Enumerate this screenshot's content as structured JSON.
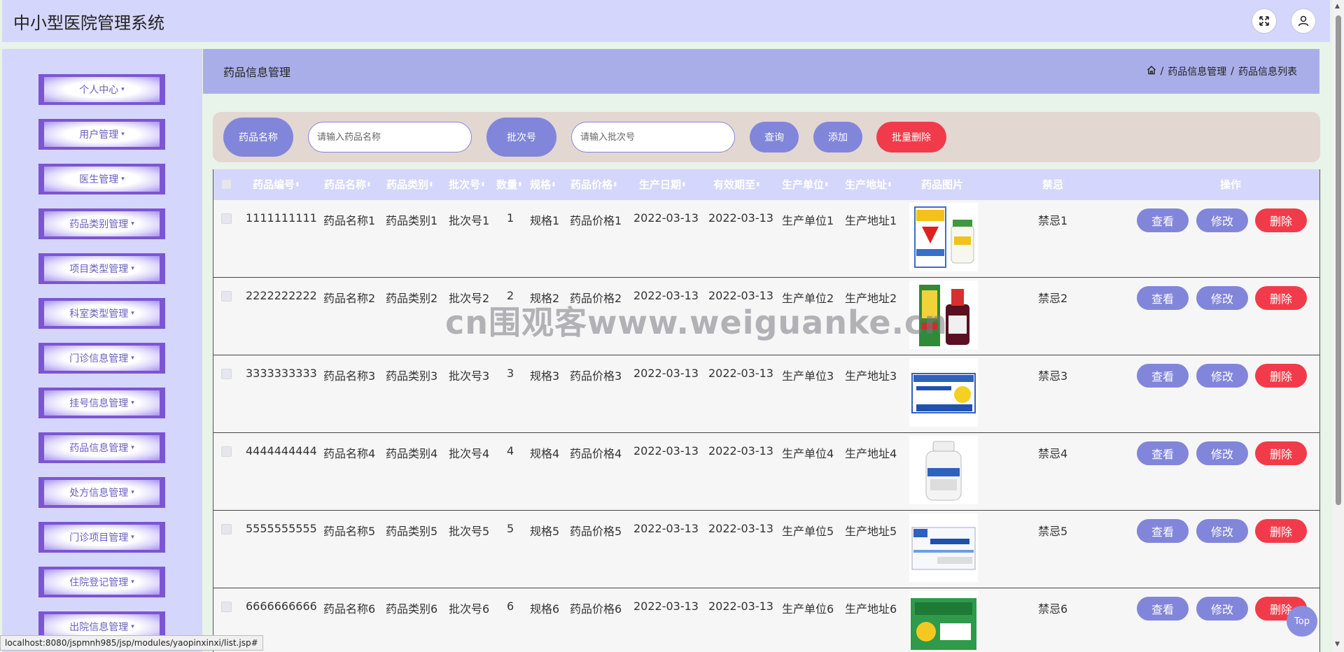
{
  "app": {
    "title": "中小型医院管理系统"
  },
  "sidebar": {
    "items": [
      {
        "label": "个人中心"
      },
      {
        "label": "用户管理"
      },
      {
        "label": "医生管理"
      },
      {
        "label": "药品类别管理"
      },
      {
        "label": "项目类型管理"
      },
      {
        "label": "科室类型管理"
      },
      {
        "label": "门诊信息管理"
      },
      {
        "label": "挂号信息管理"
      },
      {
        "label": "药品信息管理"
      },
      {
        "label": "处方信息管理"
      },
      {
        "label": "门诊项目管理"
      },
      {
        "label": "住院登记管理"
      },
      {
        "label": "出院信息管理"
      }
    ],
    "caret": "▾"
  },
  "header": {
    "page_title": "药品信息管理",
    "breadcrumb": [
      "药品信息管理",
      "药品信息列表"
    ],
    "separator": "/"
  },
  "search": {
    "name_label": "药品名称",
    "name_placeholder": "请输入药品名称",
    "batch_label": "批次号",
    "batch_placeholder": "请输入批次号",
    "query_button": "查询",
    "add_button": "添加",
    "batch_delete_button": "批量删除"
  },
  "table": {
    "columns": [
      "药品编号",
      "药品名称",
      "药品类别",
      "批次号",
      "数量",
      "规格",
      "药品价格",
      "生产日期",
      "有效期至",
      "生产单位",
      "生产地址",
      "药品图片",
      "禁忌",
      "操作"
    ],
    "sort_icon": "⬍",
    "rows": [
      {
        "id": "1111111111",
        "name": "药品名称1",
        "category": "药品类别1",
        "batch": "批次号1",
        "qty": "1",
        "spec": "规格1",
        "price": "药品价格1",
        "mfg_date": "2022-03-13",
        "exp_date": "2022-03-13",
        "maker": "生产单位1",
        "address": "生产地址1",
        "taboo": "禁忌1",
        "image": "vitamin-c-tablets-image"
      },
      {
        "id": "2222222222",
        "name": "药品名称2",
        "category": "药品类别2",
        "batch": "批次号2",
        "qty": "2",
        "spec": "规格2",
        "price": "药品价格2",
        "mfg_date": "2022-03-13",
        "exp_date": "2022-03-13",
        "maker": "生产单位2",
        "address": "生产地址2",
        "taboo": "禁忌2",
        "image": "syrup-bottle-image"
      },
      {
        "id": "3333333333",
        "name": "药品名称3",
        "category": "药品类别3",
        "batch": "批次号3",
        "qty": "3",
        "spec": "规格3",
        "price": "药品价格3",
        "mfg_date": "2022-03-13",
        "exp_date": "2022-03-13",
        "maker": "生产单位3",
        "address": "生产地址3",
        "taboo": "禁忌3",
        "image": "granules-box-image"
      },
      {
        "id": "4444444444",
        "name": "药品名称4",
        "category": "药品类别4",
        "batch": "批次号4",
        "qty": "4",
        "spec": "规格4",
        "price": "药品价格4",
        "mfg_date": "2022-03-13",
        "exp_date": "2022-03-13",
        "maker": "生产单位4",
        "address": "生产地址4",
        "taboo": "禁忌4",
        "image": "white-pill-bottle-image"
      },
      {
        "id": "5555555555",
        "name": "药品名称5",
        "category": "药品类别5",
        "batch": "批次号5",
        "qty": "5",
        "spec": "规格5",
        "price": "药品价格5",
        "mfg_date": "2022-03-13",
        "exp_date": "2022-03-13",
        "maker": "生产单位5",
        "address": "生产地址5",
        "taboo": "禁忌5",
        "image": "capsule-box-image"
      },
      {
        "id": "6666666666",
        "name": "药品名称6",
        "category": "药品类别6",
        "batch": "批次号6",
        "qty": "6",
        "spec": "规格6",
        "price": "药品价格6",
        "mfg_date": "2022-03-13",
        "exp_date": "2022-03-13",
        "maker": "生产单位6",
        "address": "生产地址6",
        "taboo": "禁忌6",
        "image": "cold-granules-box-image"
      }
    ],
    "actions": {
      "view": "查看",
      "edit": "修改",
      "delete": "删除"
    }
  },
  "watermark": "cn围观客www.weiguanke.cn",
  "status_url": "localhost:8080/jspmnh985/jsp/modules/yaopinxinxi/list.jsp#",
  "back_to_top": "Top",
  "colors": {
    "header_bg": "#d5d6fb",
    "primary": "#8286da",
    "danger": "#f23b4a",
    "crumbbar_bg": "#aaaee8",
    "search_bg": "#e3d7d2"
  }
}
